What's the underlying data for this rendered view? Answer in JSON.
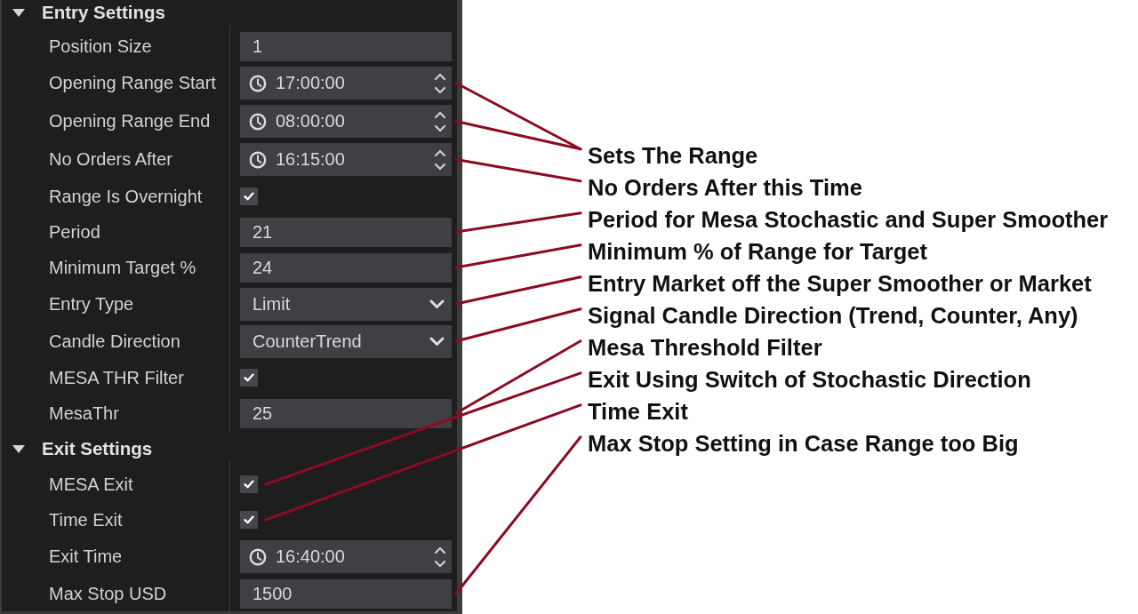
{
  "sections": [
    {
      "title": "Entry Settings",
      "expanded": true,
      "rows": [
        {
          "label": "Position Size",
          "kind": "number",
          "value": "1"
        },
        {
          "label": "Opening Range Start",
          "kind": "time",
          "value": "17:00:00"
        },
        {
          "label": "Opening Range End",
          "kind": "time",
          "value": "08:00:00"
        },
        {
          "label": "No Orders After",
          "kind": "time",
          "value": "16:15:00"
        },
        {
          "label": "Range Is Overnight",
          "kind": "checkbox",
          "checked": true
        },
        {
          "label": "Period",
          "kind": "number",
          "value": "21"
        },
        {
          "label": "Minimum Target %",
          "kind": "number",
          "value": "24"
        },
        {
          "label": "Entry Type",
          "kind": "select",
          "value": "Limit"
        },
        {
          "label": "Candle Direction",
          "kind": "select",
          "value": "CounterTrend"
        },
        {
          "label": "MESA THR Filter",
          "kind": "checkbox",
          "checked": true
        },
        {
          "label": "MesaThr",
          "kind": "number",
          "value": "25"
        }
      ]
    },
    {
      "title": "Exit Settings",
      "expanded": true,
      "rows": [
        {
          "label": "MESA Exit",
          "kind": "checkbox",
          "checked": true
        },
        {
          "label": "Time Exit",
          "kind": "checkbox",
          "checked": true
        },
        {
          "label": "Exit Time",
          "kind": "time",
          "value": "16:40:00"
        },
        {
          "label": "Max Stop USD",
          "kind": "number",
          "value": "1500"
        }
      ]
    }
  ],
  "annotations": [
    {
      "text": "Sets The Range"
    },
    {
      "text": "No Orders After this Time"
    },
    {
      "text": "Period for Mesa Stochastic and Super Smoother"
    },
    {
      "text": "Minimum % of Range for Target"
    },
    {
      "text": "Entry Market off the Super Smoother or Market"
    },
    {
      "text": "Signal Candle Direction (Trend, Counter, Any)"
    },
    {
      "text": "Mesa Threshold Filter"
    },
    {
      "text": "Exit Using Switch of Stochastic Direction"
    },
    {
      "text": "Time Exit"
    },
    {
      "text": "Max Stop Setting in Case Range too Big"
    }
  ]
}
